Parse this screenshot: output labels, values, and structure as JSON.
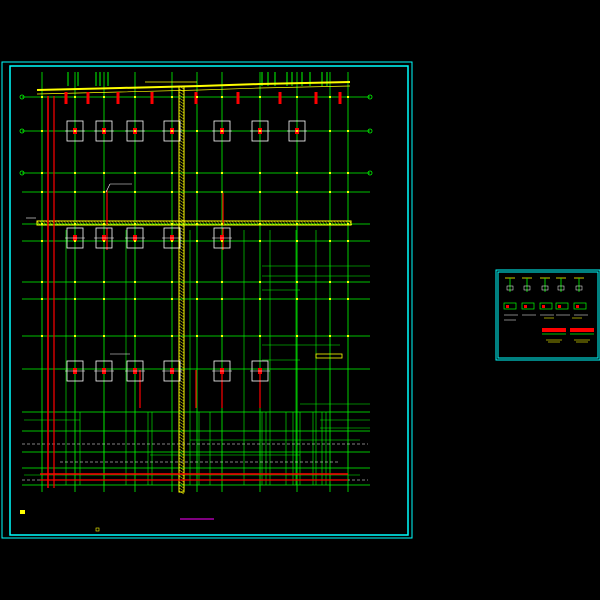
{
  "colors": {
    "background": "#000000",
    "frame": "#00ffff",
    "grid": "#00ff00",
    "column": "#ffffff",
    "rebar": "#ff0000",
    "beam": "#ffff00",
    "accent": "#ff00ff"
  },
  "drawing": {
    "main_sheet": "main-plan",
    "detail_sheet": "detail-sheet",
    "grid_bubbles": "axis-bubble-icon",
    "column_symbol": "column-footing-icon"
  }
}
